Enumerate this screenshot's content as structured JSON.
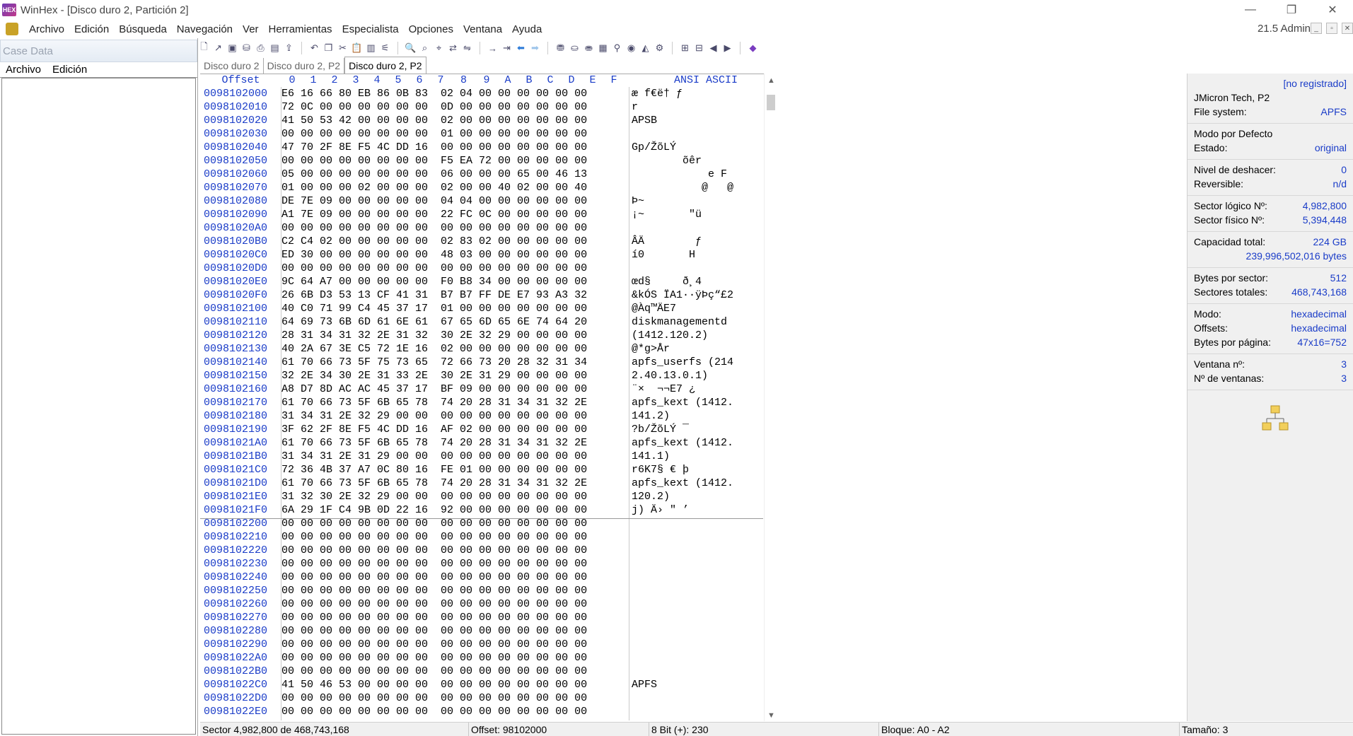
{
  "window": {
    "title": "WinHex - [Disco duro 2, Partición 2]",
    "app_icon_text": "HEX",
    "minimize": "—",
    "restore": "❐",
    "close": "✕"
  },
  "menu": {
    "items": [
      "Archivo",
      "Edición",
      "Búsqueda",
      "Navegación",
      "Ver",
      "Herramientas",
      "Especialista",
      "Opciones",
      "Ventana",
      "Ayuda"
    ],
    "right_label": "21.5 Admin"
  },
  "left_panel": {
    "title": "Case Data",
    "menu": [
      "Archivo",
      "Edición"
    ]
  },
  "tabs": [
    {
      "label": "Disco duro 2"
    },
    {
      "label": "Disco duro 2, P2"
    },
    {
      "label": "Disco duro 2, P2",
      "active": true
    }
  ],
  "hex": {
    "header_offset": "Offset",
    "header_cols": [
      "0",
      "1",
      "2",
      "3",
      "4",
      "5",
      "6",
      "7",
      "8",
      "9",
      "A",
      "B",
      "C",
      "D",
      "E",
      "F"
    ],
    "header_ascii": "ANSI ASCII",
    "rows": [
      {
        "off": "0098102000",
        "hex": "E6 16 66 80 EB 86 0B 83  02 04 00 00 00 00 00 00",
        "ascii": "æ f€ë† ƒ"
      },
      {
        "off": "0098102010",
        "hex": "72 0C 00 00 00 00 00 00  0D 00 00 00 00 00 00 00",
        "ascii": "r"
      },
      {
        "off": "0098102020",
        "hex": "41 50 53 42 00 00 00 00  02 00 00 00 00 00 00 00",
        "ascii": "APSB"
      },
      {
        "off": "0098102030",
        "hex": "00 00 00 00 00 00 00 00  01 00 00 00 00 00 00 00",
        "ascii": ""
      },
      {
        "off": "0098102040",
        "hex": "47 70 2F 8E F5 4C DD 16  00 00 00 00 00 00 00 00",
        "ascii": "Gp/ŽõLÝ"
      },
      {
        "off": "0098102050",
        "hex": "00 00 00 00 00 00 00 00  F5 EA 72 00 00 00 00 00",
        "ascii": "        õêr"
      },
      {
        "off": "0098102060",
        "hex": "05 00 00 00 00 00 00 00  06 00 00 00 65 00 46 13",
        "ascii": "            e F"
      },
      {
        "off": "0098102070",
        "hex": "01 00 00 00 02 00 00 00  02 00 00 40 02 00 00 40",
        "ascii": "           @   @"
      },
      {
        "off": "0098102080",
        "hex": "DE 7E 09 00 00 00 00 00  04 04 00 00 00 00 00 00",
        "ascii": "Þ~"
      },
      {
        "off": "0098102090",
        "hex": "A1 7E 09 00 00 00 00 00  22 FC 0C 00 00 00 00 00",
        "ascii": "¡~       \"ü"
      },
      {
        "off": "00981020A0",
        "hex": "00 00 00 00 00 00 00 00  00 00 00 00 00 00 00 00",
        "ascii": ""
      },
      {
        "off": "00981020B0",
        "hex": "C2 C4 02 00 00 00 00 00  02 83 02 00 00 00 00 00",
        "ascii": "ÂÄ        ƒ"
      },
      {
        "off": "00981020C0",
        "hex": "ED 30 00 00 00 00 00 00  48 03 00 00 00 00 00 00",
        "ascii": "í0       H"
      },
      {
        "off": "00981020D0",
        "hex": "00 00 00 00 00 00 00 00  00 00 00 00 00 00 00 00",
        "ascii": ""
      },
      {
        "off": "00981020E0",
        "hex": "9C 64 A7 00 00 00 00 00  F0 B8 34 00 00 00 00 00",
        "ascii": "œd§     ð¸4"
      },
      {
        "off": "00981020F0",
        "hex": "26 6B D3 53 13 CF 41 31  B7 B7 FF DE E7 93 A3 32",
        "ascii": "&kÓS ÏA1··ÿÞç“£2"
      },
      {
        "off": "0098102100",
        "hex": "40 C0 71 99 C4 45 37 17  01 00 00 00 00 00 00 00",
        "ascii": "@Àq™ÄE7"
      },
      {
        "off": "0098102110",
        "hex": "64 69 73 6B 6D 61 6E 61  67 65 6D 65 6E 74 64 20",
        "ascii": "diskmanagementd"
      },
      {
        "off": "0098102120",
        "hex": "28 31 34 31 32 2E 31 32  30 2E 32 29 00 00 00 00",
        "ascii": "(1412.120.2)"
      },
      {
        "off": "0098102130",
        "hex": "40 2A 67 3E C5 72 1E 16  02 00 00 00 00 00 00 00",
        "ascii": "@*g>År"
      },
      {
        "off": "0098102140",
        "hex": "61 70 66 73 5F 75 73 65  72 66 73 20 28 32 31 34",
        "ascii": "apfs_userfs (214"
      },
      {
        "off": "0098102150",
        "hex": "32 2E 34 30 2E 31 33 2E  30 2E 31 29 00 00 00 00",
        "ascii": "2.40.13.0.1)"
      },
      {
        "off": "0098102160",
        "hex": "A8 D7 8D AC AC 45 37 17  BF 09 00 00 00 00 00 00",
        "ascii": "¨×  ¬¬E7 ¿"
      },
      {
        "off": "0098102170",
        "hex": "61 70 66 73 5F 6B 65 78  74 20 28 31 34 31 32 2E",
        "ascii": "apfs_kext (1412."
      },
      {
        "off": "0098102180",
        "hex": "31 34 31 2E 32 29 00 00  00 00 00 00 00 00 00 00",
        "ascii": "141.2)"
      },
      {
        "off": "0098102190",
        "hex": "3F 62 2F 8E F5 4C DD 16  AF 02 00 00 00 00 00 00",
        "ascii": "?b/ŽõLÝ ¯"
      },
      {
        "off": "00981021A0",
        "hex": "61 70 66 73 5F 6B 65 78  74 20 28 31 34 31 32 2E",
        "ascii": "apfs_kext (1412."
      },
      {
        "off": "00981021B0",
        "hex": "31 34 31 2E 31 29 00 00  00 00 00 00 00 00 00 00",
        "ascii": "141.1)"
      },
      {
        "off": "00981021C0",
        "hex": "72 36 4B 37 A7 0C 80 16  FE 01 00 00 00 00 00 00",
        "ascii": "r6K7§ € þ"
      },
      {
        "off": "00981021D0",
        "hex": "61 70 66 73 5F 6B 65 78  74 20 28 31 34 31 32 2E",
        "ascii": "apfs_kext (1412."
      },
      {
        "off": "00981021E0",
        "hex": "31 32 30 2E 32 29 00 00  00 00 00 00 00 00 00 00",
        "ascii": "120.2)"
      },
      {
        "off": "00981021F0",
        "hex": "6A 29 1F C4 9B 0D 22 16  92 00 00 00 00 00 00 00",
        "ascii": "j) Ä› \" ’"
      },
      {
        "off": "0098102200",
        "hex": "00 00 00 00 00 00 00 00  00 00 00 00 00 00 00 00",
        "ascii": ""
      },
      {
        "off": "0098102210",
        "hex": "00 00 00 00 00 00 00 00  00 00 00 00 00 00 00 00",
        "ascii": ""
      },
      {
        "off": "0098102220",
        "hex": "00 00 00 00 00 00 00 00  00 00 00 00 00 00 00 00",
        "ascii": ""
      },
      {
        "off": "0098102230",
        "hex": "00 00 00 00 00 00 00 00  00 00 00 00 00 00 00 00",
        "ascii": ""
      },
      {
        "off": "0098102240",
        "hex": "00 00 00 00 00 00 00 00  00 00 00 00 00 00 00 00",
        "ascii": ""
      },
      {
        "off": "0098102250",
        "hex": "00 00 00 00 00 00 00 00  00 00 00 00 00 00 00 00",
        "ascii": ""
      },
      {
        "off": "0098102260",
        "hex": "00 00 00 00 00 00 00 00  00 00 00 00 00 00 00 00",
        "ascii": ""
      },
      {
        "off": "0098102270",
        "hex": "00 00 00 00 00 00 00 00  00 00 00 00 00 00 00 00",
        "ascii": ""
      },
      {
        "off": "0098102280",
        "hex": "00 00 00 00 00 00 00 00  00 00 00 00 00 00 00 00",
        "ascii": ""
      },
      {
        "off": "0098102290",
        "hex": "00 00 00 00 00 00 00 00  00 00 00 00 00 00 00 00",
        "ascii": ""
      },
      {
        "off": "00981022A0",
        "hex": "00 00 00 00 00 00 00 00  00 00 00 00 00 00 00 00",
        "ascii": ""
      },
      {
        "off": "00981022B0",
        "hex": "00 00 00 00 00 00 00 00  00 00 00 00 00 00 00 00",
        "ascii": ""
      },
      {
        "off": "00981022C0",
        "hex": "41 50 46 53 00 00 00 00  00 00 00 00 00 00 00 00",
        "ascii": "APFS"
      },
      {
        "off": "00981022D0",
        "hex": "00 00 00 00 00 00 00 00  00 00 00 00 00 00 00 00",
        "ascii": ""
      },
      {
        "off": "00981022E0",
        "hex": "00 00 00 00 00 00 00 00  00 00 00 00 00 00 00 00",
        "ascii": ""
      }
    ]
  },
  "info": {
    "unregistered": "[no registrado]",
    "device": "JMicron Tech, P2",
    "filesystem_label": "File system:",
    "filesystem": "APFS",
    "mode_default": "Modo por Defecto",
    "state_label": "Estado:",
    "state": "original",
    "undo_label": "Nivel de deshacer:",
    "undo": "0",
    "reversible_label": "Reversible:",
    "reversible": "n/d",
    "logical_label": "Sector lógico Nº:",
    "logical": "4,982,800",
    "physical_label": "Sector físico Nº:",
    "physical": "5,394,448",
    "capacity_label": "Capacidad total:",
    "capacity": "224 GB",
    "capacity_bytes": "239,996,502,016 bytes",
    "bps_label": "Bytes por sector:",
    "bps": "512",
    "total_sectors_label": "Sectores totales:",
    "total_sectors": "468,743,168",
    "mode_label": "Modo:",
    "mode": "hexadecimal",
    "offsets_label": "Offsets:",
    "offsets": "hexadecimal",
    "bpp_label": "Bytes por página:",
    "bpp": "47x16=752",
    "window_label": "Ventana nº:",
    "window": "3",
    "windows_label": "Nº de ventanas:",
    "windows": "3"
  },
  "status": {
    "sector": "Sector 4,982,800 de 468,743,168",
    "offset": "Offset: 98102000",
    "bit": "8 Bit (+): 230",
    "block": "Bloque: A0 - A2",
    "size": "Tamaño: 3"
  }
}
